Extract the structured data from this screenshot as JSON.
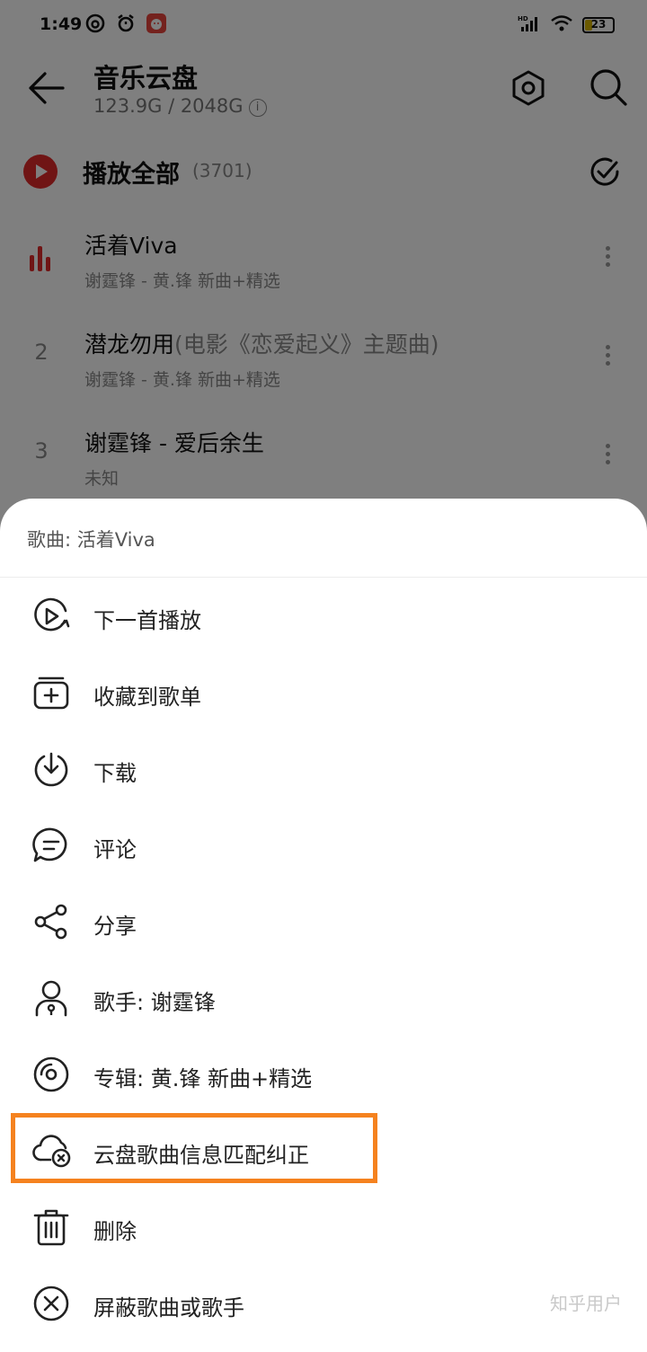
{
  "status_bar": {
    "time": "1:49",
    "battery": "23"
  },
  "header": {
    "title": "音乐云盘",
    "storage": "123.9G / 2048G",
    "info_glyph": "i"
  },
  "play_all": {
    "label": "播放全部",
    "count": "(3701)"
  },
  "songs": [
    {
      "index": "",
      "title": "活着Viva",
      "title_extra": "",
      "subtitle": "谢霆锋 - 黄.锋 新曲+精选",
      "playing": true
    },
    {
      "index": "2",
      "title": "潜龙勿用",
      "title_extra": "(电影《恋爱起义》主题曲)",
      "subtitle": "谢霆锋 - 黄.锋 新曲+精选",
      "playing": false
    },
    {
      "index": "3",
      "title": "谢霆锋 - 爱后余生",
      "title_extra": "",
      "subtitle": "未知",
      "playing": false
    }
  ],
  "sheet": {
    "header": "歌曲: 活着Viva",
    "items": [
      {
        "label": "下一首播放",
        "icon": "play-next-icon"
      },
      {
        "label": "收藏到歌单",
        "icon": "add-to-playlist-icon"
      },
      {
        "label": "下载",
        "icon": "download-icon"
      },
      {
        "label": "评论",
        "icon": "comment-icon"
      },
      {
        "label": "分享",
        "icon": "share-icon"
      },
      {
        "label": "歌手: 谢霆锋",
        "icon": "artist-icon"
      },
      {
        "label": "专辑: 黄.锋 新曲+精选",
        "icon": "album-icon"
      },
      {
        "label": "云盘歌曲信息匹配纠正",
        "icon": "cloud-correct-icon"
      },
      {
        "label": "删除",
        "icon": "trash-icon"
      },
      {
        "label": "屏蔽歌曲或歌手",
        "icon": "block-icon"
      }
    ]
  },
  "watermark": "知乎用户",
  "colors": {
    "accent_red": "#e02b2b",
    "highlight_orange": "#f5821f"
  }
}
